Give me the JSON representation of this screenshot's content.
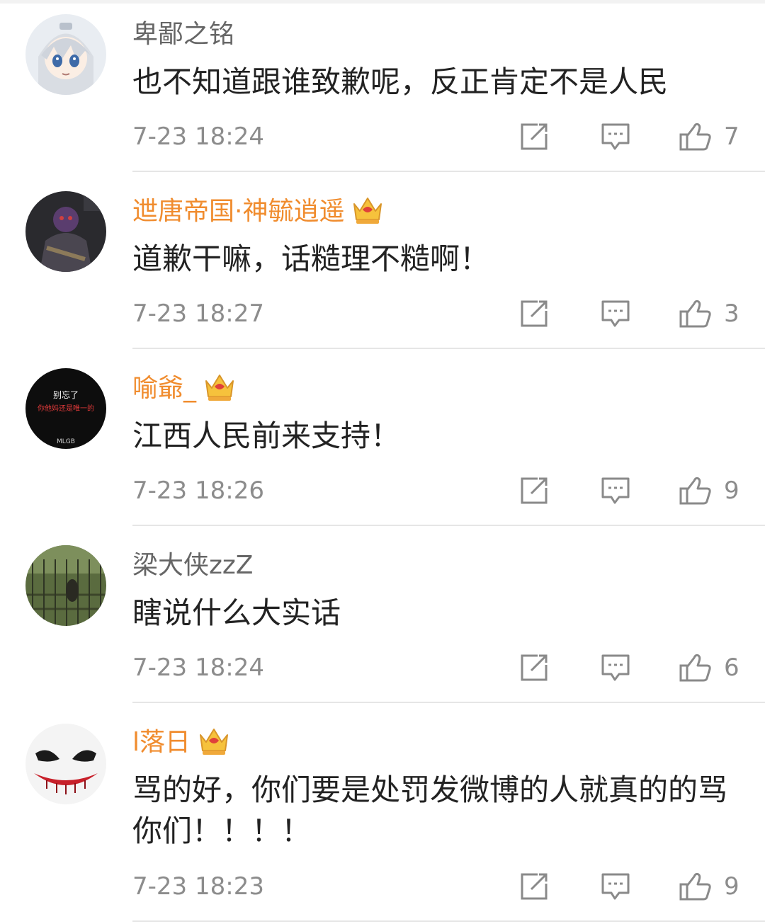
{
  "comments": [
    {
      "username": "卑鄙之铭",
      "vip": false,
      "text": "也不知道跟谁致歉呢，反正肯定不是人民",
      "time": "7-23 18:24",
      "likes": "7"
    },
    {
      "username": "迣唐帝国·神毓逍遥",
      "vip": true,
      "text": "道歉干嘛，话糙理不糙啊！",
      "time": "7-23 18:27",
      "likes": "3"
    },
    {
      "username": "喻爺_",
      "vip": true,
      "text": "江西人民前来支持！",
      "time": "7-23 18:26",
      "likes": "9",
      "avatar_text": [
        "别忘了",
        "你他妈还是唯一的",
        "MLGB"
      ]
    },
    {
      "username": "梁大侠zzZ",
      "vip": false,
      "text": "瞎说什么大实话",
      "time": "7-23 18:24",
      "likes": "6"
    },
    {
      "username": "l落日",
      "vip": true,
      "text": "骂的好，你们要是处罚发微博的人就真的的骂你们！！！！",
      "time": "7-23 18:23",
      "likes": "9"
    }
  ],
  "colors": {
    "vip_name": "#f08c2e",
    "normal_name": "#666666",
    "text": "#222222",
    "meta": "#8c8c8c",
    "divider": "#e6e6e6"
  },
  "icons": [
    "share-icon",
    "comment-icon",
    "like-icon",
    "crown-icon"
  ]
}
